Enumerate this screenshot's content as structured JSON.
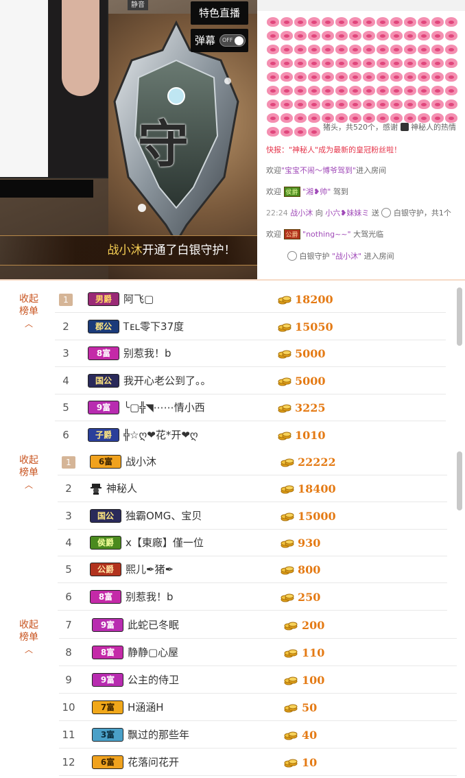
{
  "video": {
    "mute_label": "静音",
    "special_live_label": "特色直播",
    "danmu_label": "弹幕",
    "danmu_toggle": "OFF",
    "shield_char": "守",
    "banner": {
      "name": "战小沐",
      "text": "开通了白银守护！"
    }
  },
  "chat": {
    "pig_count_line": {
      "suffix": "猪头，共520个，感谢",
      "user": "神秘人的热情"
    },
    "flash": "快报：\"神秘人\"成为最新的皇冠粉丝啦！",
    "welcome1": {
      "pre": "欢迎",
      "name": "\"宝宝不闹～博爷驾到\"",
      "post": "进入房间"
    },
    "welcome2": {
      "pre": "欢迎",
      "badge": "侯爵",
      "name": "\"湘❥帅\"",
      "post": "驾到"
    },
    "gift_line": {
      "time": "22:24",
      "from": "战小沐",
      "to_pre": "向",
      "to": "小六❥妹妹ミ",
      "send": "送",
      "item": "白银守护，共1个"
    },
    "line5": {
      "pre": "欢迎",
      "badge": "公爵",
      "name": "\"nothing~~\"",
      "post": "大驾光临"
    },
    "line6": {
      "pre": "白银守护",
      "name": "\"战小沐\"",
      "post": "进入房间"
    }
  },
  "colors": {
    "accent": "#e47a14",
    "collapse": "#c8531e",
    "badge_baron": "#9a2a76",
    "badge_duke": "#1b3b7a",
    "badge_fu8": "#c42aa8",
    "badge_fu9": "#b82cb0",
    "badge_guogong": "#2a2a5a",
    "badge_zijue": "#2a3f9a",
    "badge_houjue": "#4a8a1e",
    "badge_gongjue": "#b2331e",
    "badge_fu6": "#f0a21e",
    "badge_fu7": "#f1a81a",
    "badge_fu3": "#4aa0c8"
  },
  "panel1": {
    "collapse_label": "收起\n榜单",
    "rows": [
      {
        "rank": "1",
        "badge": "男爵",
        "name": "阿飞▢",
        "score": "18200"
      },
      {
        "rank": "2",
        "badge": "郡公",
        "name": "Ꭲᴇʟ零下37度",
        "score": "15050"
      },
      {
        "rank": "3",
        "badge": "8富",
        "name": "别惹我！b",
        "score": "5000"
      },
      {
        "rank": "4",
        "badge": "国公",
        "name": "我开心老公到了。。",
        "score": "5000"
      },
      {
        "rank": "5",
        "badge": "9富",
        "name": "╰▢╬◥⋯⋯情小西",
        "score": "3225"
      },
      {
        "rank": "6",
        "badge": "子爵",
        "name": "╬☆ღ❤花*开❤ღ",
        "score": "1010"
      }
    ]
  },
  "panel2": {
    "collapse_label": "收起\n榜单",
    "rows": [
      {
        "rank": "1",
        "badge": "6富",
        "name": "战小沐",
        "score": "22222"
      },
      {
        "rank": "2",
        "badge": "",
        "name": "神秘人",
        "score": "18400"
      },
      {
        "rank": "3",
        "badge": "国公",
        "name": "独霸OMG、宝贝",
        "score": "15000"
      },
      {
        "rank": "4",
        "badge": "侯爵",
        "name": "ⅹ【東廠】僅一位",
        "score": "930"
      },
      {
        "rank": "5",
        "badge": "公爵",
        "name": "熙儿✒猪✒",
        "score": "800"
      },
      {
        "rank": "6",
        "badge": "8富",
        "name": "别惹我！b",
        "score": "250"
      },
      {
        "rank": "7",
        "badge": "9富",
        "name": "此蛇已冬眠",
        "score": "200"
      },
      {
        "rank": "8",
        "badge": "8富",
        "name": "静静▢心屋",
        "score": "110"
      },
      {
        "rank": "9",
        "badge": "9富",
        "name": "公主的侍卫",
        "score": "100"
      },
      {
        "rank": "10",
        "badge": "7富",
        "name": "H涵涵H",
        "score": "50"
      },
      {
        "rank": "11",
        "badge": "3富",
        "name": "飘过的那些年",
        "score": "40"
      },
      {
        "rank": "12",
        "badge": "6富",
        "name": "花落问花开",
        "score": "10"
      }
    ]
  }
}
